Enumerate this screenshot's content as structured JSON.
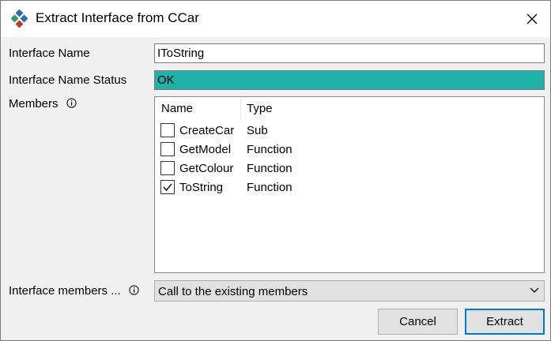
{
  "window": {
    "title": "Extract Interface from CCar"
  },
  "form": {
    "interface_name_label": "Interface Name",
    "interface_name_value": "IToString",
    "status_label": "Interface Name Status",
    "status_value": "OK",
    "status_color": "#20b2aa",
    "members_label": "Members",
    "interface_members_label": "Interface members ...",
    "interface_members_value": "Call to the existing members"
  },
  "members": {
    "columns": [
      "Name",
      "Type"
    ],
    "rows": [
      {
        "name": "CreateCar",
        "type": "Sub",
        "checked": false
      },
      {
        "name": "GetModel",
        "type": "Function",
        "checked": false
      },
      {
        "name": "GetColour",
        "type": "Function",
        "checked": false
      },
      {
        "name": "ToString",
        "type": "Function",
        "checked": true
      }
    ]
  },
  "buttons": {
    "cancel": "Cancel",
    "extract": "Extract"
  },
  "icons": {
    "app": "diamond-logo-icon",
    "close": "close-icon",
    "info": "info-icon",
    "dropdown": "chevron-down-icon",
    "check": "checkmark-icon"
  }
}
